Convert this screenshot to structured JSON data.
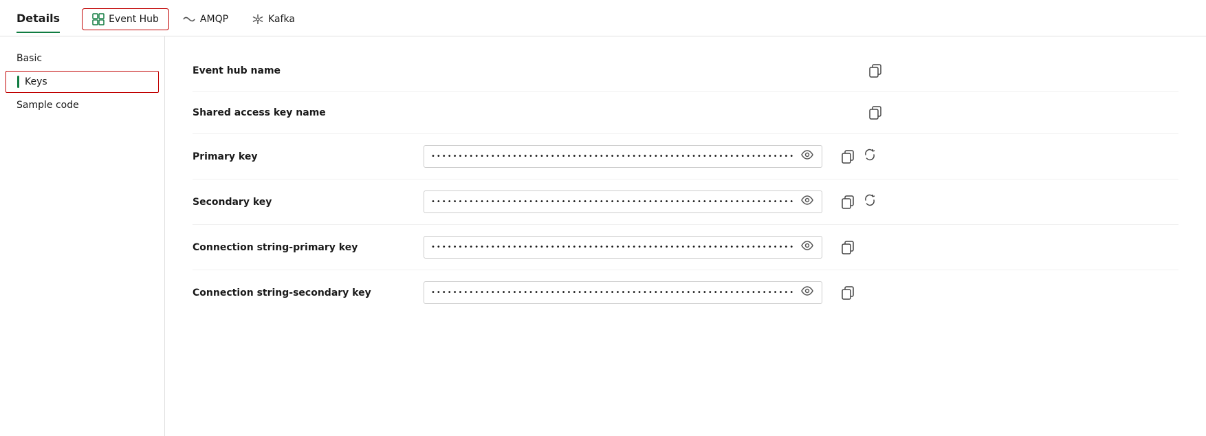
{
  "header": {
    "title": "Details",
    "title_underline_color": "#107c41"
  },
  "connection_tabs": [
    {
      "id": "eventhub",
      "label": "Event Hub",
      "icon": "eventhub",
      "active": true
    },
    {
      "id": "amqp",
      "label": "AMQP",
      "icon": "amqp",
      "active": false
    },
    {
      "id": "kafka",
      "label": "Kafka",
      "icon": "kafka",
      "active": false
    }
  ],
  "sidebar": {
    "items": [
      {
        "id": "basic",
        "label": "Basic",
        "active": false
      },
      {
        "id": "keys",
        "label": "Keys",
        "active": true
      },
      {
        "id": "sample_code",
        "label": "Sample code",
        "active": false
      }
    ]
  },
  "fields": [
    {
      "id": "event_hub_name",
      "label": "Event hub name",
      "type": "text_with_copy",
      "value": "",
      "masked": false,
      "show_copy": true,
      "show_eye": false,
      "show_refresh": false
    },
    {
      "id": "shared_access_key_name",
      "label": "Shared access key name",
      "type": "text_with_copy",
      "value": "",
      "masked": false,
      "show_copy": true,
      "show_eye": false,
      "show_refresh": false
    },
    {
      "id": "primary_key",
      "label": "Primary key",
      "type": "masked_with_actions",
      "value": "",
      "masked": true,
      "dots": "••••••••••••••••••••••••••••••••••••••••••••••••••••••••••••••••••••",
      "show_copy": true,
      "show_eye": true,
      "show_refresh": true
    },
    {
      "id": "secondary_key",
      "label": "Secondary key",
      "type": "masked_with_actions",
      "value": "",
      "masked": true,
      "dots": "••••••••••••••••••••••••••••••••••••••••••••••••••••••••••••••••••••",
      "show_copy": true,
      "show_eye": true,
      "show_refresh": true
    },
    {
      "id": "connection_string_primary",
      "label": "Connection string-primary key",
      "type": "masked_with_actions",
      "value": "",
      "masked": true,
      "dots": "••••••••••••••••••••••••••••••••••••••••••••••••••••••••••••••••••••",
      "show_copy": true,
      "show_eye": true,
      "show_refresh": false
    },
    {
      "id": "connection_string_secondary",
      "label": "Connection string-secondary key",
      "type": "masked_with_actions",
      "value": "",
      "masked": true,
      "dots": "••••••••••••••••••••••••••••••••••••••••••••••••••••••••••••••••••••",
      "show_copy": true,
      "show_eye": true,
      "show_refresh": false
    }
  ],
  "icons": {
    "copy": "⧉",
    "eye": "👁",
    "refresh": "↻",
    "eventhub": "⊞",
    "amqp": "◇◇",
    "kafka": "✱"
  }
}
